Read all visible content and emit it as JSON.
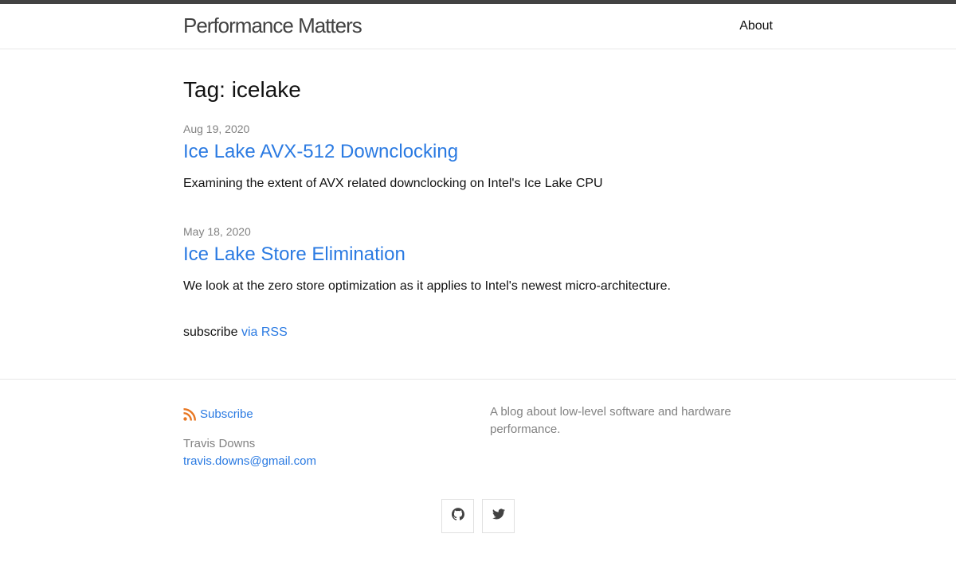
{
  "header": {
    "site_title": "Performance Matters",
    "nav": [
      {
        "label": "About"
      }
    ]
  },
  "main": {
    "heading": "Tag: icelake",
    "posts": [
      {
        "date": "Aug 19, 2020",
        "title": "Ice Lake AVX-512 Downclocking",
        "excerpt": "Examining the extent of AVX related downclocking on Intel's Ice Lake CPU"
      },
      {
        "date": "May 18, 2020",
        "title": "Ice Lake Store Elimination",
        "excerpt": "We look at the zero store optimization as it applies to Intel's newest micro-architecture."
      }
    ],
    "subscribe_prefix": "subscribe",
    "subscribe_link": "via RSS"
  },
  "footer": {
    "subscribe_label": "Subscribe",
    "author_name": "Travis Downs",
    "email": "travis.downs@gmail.com",
    "description": "A blog about low-level software and hardware performance.",
    "social": [
      {
        "icon": "github-icon"
      },
      {
        "icon": "twitter-icon"
      }
    ]
  },
  "colors": {
    "link": "#2a7ae2",
    "rss": "#e87722",
    "topbar": "#424242",
    "muted": "#828282"
  }
}
